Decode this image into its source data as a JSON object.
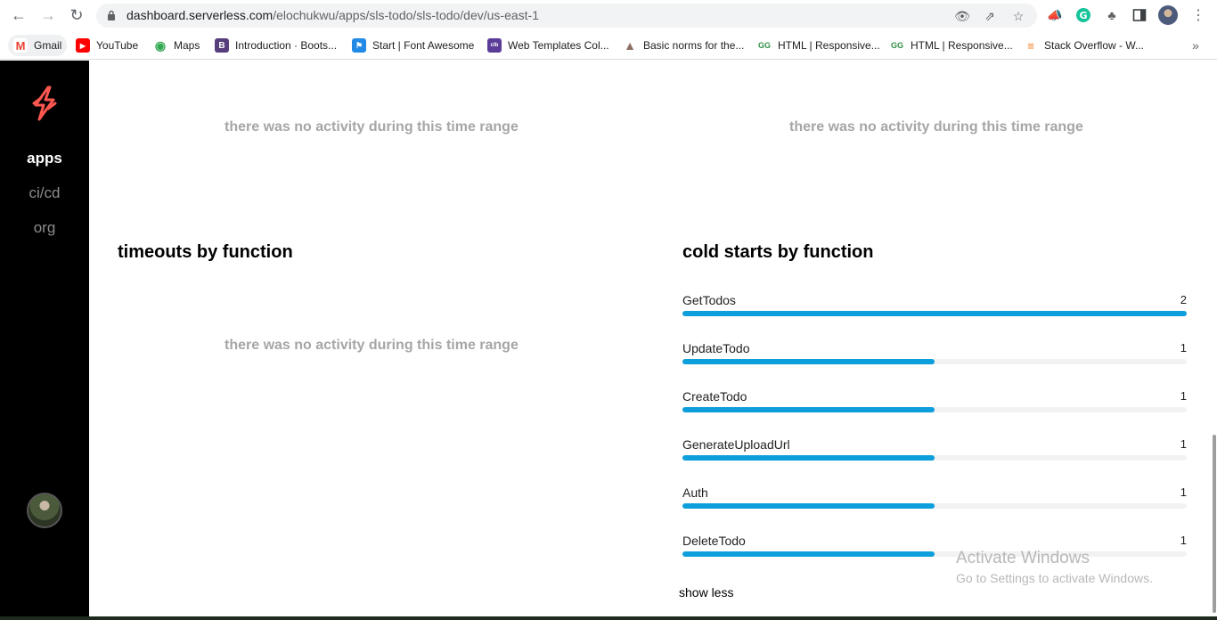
{
  "browser": {
    "url_host": "dashboard.serverless.com",
    "url_path": "/elochukwu/apps/sls-todo/sls-todo/dev/us-east-1",
    "bookmarks": [
      {
        "label": "Gmail",
        "icon": "gmail-icon",
        "color": "#ea4335"
      },
      {
        "label": "YouTube",
        "icon": "youtube-icon",
        "color": "#ff0000"
      },
      {
        "label": "Maps",
        "icon": "maps-icon",
        "color": "#34a853"
      },
      {
        "label": "Introduction · Boots...",
        "icon": "bootstrap-icon",
        "color": "#563d7c"
      },
      {
        "label": "Start | Font Awesome",
        "icon": "font-awesome-icon",
        "color": "#228ae6"
      },
      {
        "label": "Web Templates Col...",
        "icon": "colorlib-icon",
        "color": "#5b3c99"
      },
      {
        "label": "Basic norms for the...",
        "icon": "tree-icon",
        "color": "#8d6e63"
      },
      {
        "label": "HTML | Responsive...",
        "icon": "gfg-icon",
        "color": "#2f8d46"
      },
      {
        "label": "HTML | Responsive...",
        "icon": "gfg-icon",
        "color": "#2f8d46"
      },
      {
        "label": "Stack Overflow - W...",
        "icon": "stackoverflow-icon",
        "color": "#f48024"
      }
    ]
  },
  "sidebar": {
    "items": [
      {
        "label": "apps",
        "active": true
      },
      {
        "label": "ci/cd",
        "active": false
      },
      {
        "label": "org",
        "active": false
      }
    ]
  },
  "main": {
    "empty_message": "there was no activity during this time range",
    "timeouts_title": "timeouts by function",
    "cold_starts_title": "cold starts by function",
    "cold_starts": [
      {
        "name": "GetTodos",
        "count": "2",
        "fraction": 1.0
      },
      {
        "name": "UpdateTodo",
        "count": "1",
        "fraction": 0.5
      },
      {
        "name": "CreateTodo",
        "count": "1",
        "fraction": 0.5
      },
      {
        "name": "GenerateUploadUrl",
        "count": "1",
        "fraction": 0.5
      },
      {
        "name": "Auth",
        "count": "1",
        "fraction": 0.5
      },
      {
        "name": "DeleteTodo",
        "count": "1",
        "fraction": 0.5
      }
    ],
    "show_less": "show less"
  },
  "watermark": {
    "line1": "Activate Windows",
    "line2": "Go to Settings to activate Windows."
  },
  "colors": {
    "accent": "#0d9fdb",
    "logo": "#fd5750"
  }
}
